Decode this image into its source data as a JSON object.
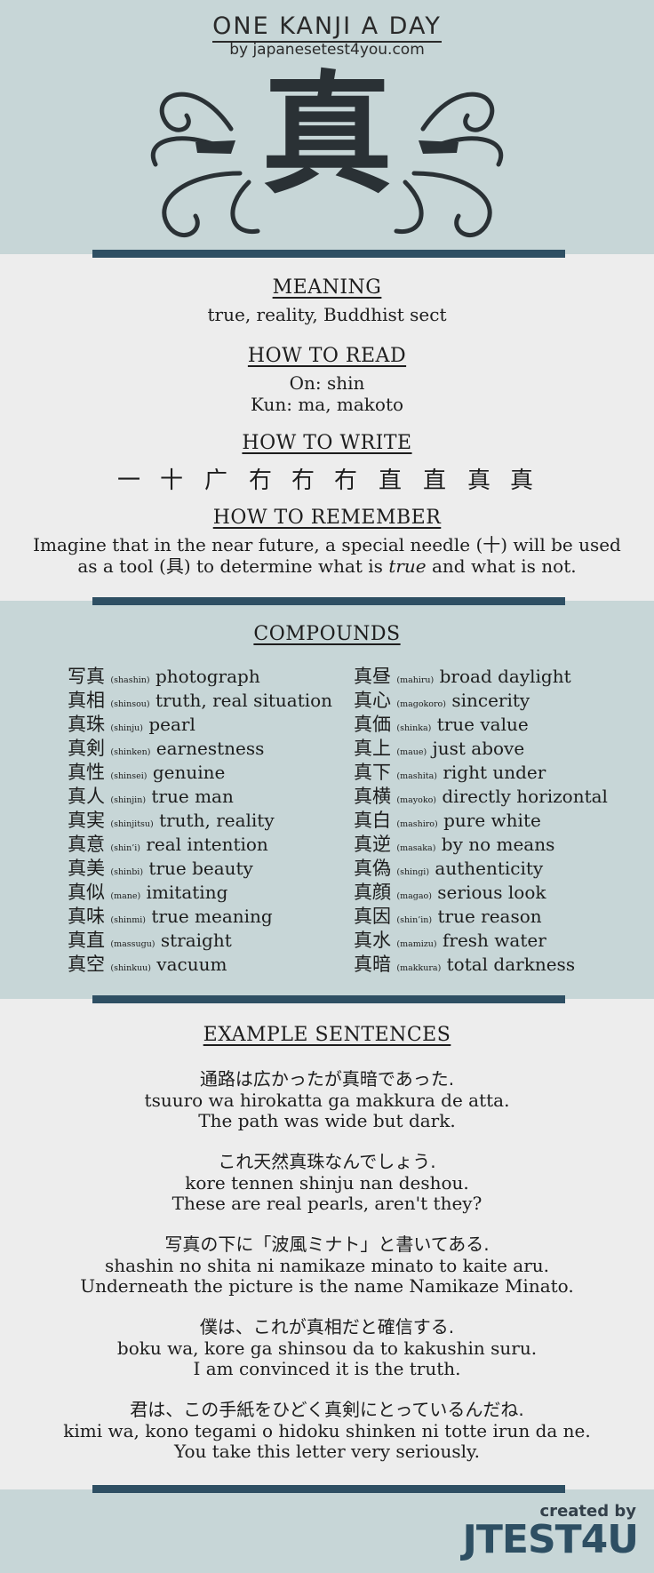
{
  "header": {
    "title": "ONE KANJI A DAY",
    "byline": "by japanesetest4you.com",
    "kanji": "真"
  },
  "meaning": {
    "heading": "MEANING",
    "text": "true, reality, Buddhist sect"
  },
  "read": {
    "heading": "HOW TO READ",
    "on": "On: shin",
    "kun": "Kun: ma, makoto"
  },
  "write": {
    "heading": "HOW TO WRITE",
    "strokes": [
      "一",
      "十",
      "广",
      "冇",
      "冇",
      "冇",
      "直",
      "直",
      "真",
      "真"
    ]
  },
  "remember": {
    "heading": "HOW TO REMEMBER",
    "line1": "Imagine that in the near future, a special needle (十) will be used",
    "line2_a": "as a tool (具) to determine what is ",
    "line2_em": "true",
    "line2_b": " and what is not."
  },
  "compounds": {
    "heading": "COMPOUNDS",
    "left": [
      {
        "k": "写真",
        "r": "(shashin)",
        "m": "photograph"
      },
      {
        "k": "真相",
        "r": "(shinsou)",
        "m": "truth, real situation"
      },
      {
        "k": "真珠",
        "r": "(shinju)",
        "m": "pearl"
      },
      {
        "k": "真剣",
        "r": "(shinken)",
        "m": "earnestness"
      },
      {
        "k": "真性",
        "r": "(shinsei)",
        "m": "genuine"
      },
      {
        "k": "真人",
        "r": "(shinjin)",
        "m": "true man"
      },
      {
        "k": "真実",
        "r": "(shinjitsu)",
        "m": "truth, reality"
      },
      {
        "k": "真意",
        "r": "(shin’i)",
        "m": "real intention"
      },
      {
        "k": "真美",
        "r": "(shinbi)",
        "m": "true beauty"
      },
      {
        "k": "真似",
        "r": "(mane)",
        "m": "imitating"
      },
      {
        "k": "真味",
        "r": "(shinmi)",
        "m": "true meaning"
      },
      {
        "k": "真直",
        "r": "(massugu)",
        "m": "straight"
      },
      {
        "k": "真空",
        "r": "(shinkuu)",
        "m": "vacuum"
      }
    ],
    "right": [
      {
        "k": "真昼",
        "r": "(mahiru)",
        "m": "broad daylight"
      },
      {
        "k": "真心",
        "r": "(magokoro)",
        "m": "sincerity"
      },
      {
        "k": "真価",
        "r": "(shinka)",
        "m": "true value"
      },
      {
        "k": "真上",
        "r": "(maue)",
        "m": "just above"
      },
      {
        "k": "真下",
        "r": "(mashita)",
        "m": "right under"
      },
      {
        "k": "真横",
        "r": "(mayoko)",
        "m": "directly horizontal"
      },
      {
        "k": "真白",
        "r": "(mashiro)",
        "m": "pure white"
      },
      {
        "k": "真逆",
        "r": "(masaka)",
        "m": "by no means"
      },
      {
        "k": "真偽",
        "r": "(shingi)",
        "m": "authenticity"
      },
      {
        "k": "真顔",
        "r": "(magao)",
        "m": "serious look"
      },
      {
        "k": "真因",
        "r": "(shin’in)",
        "m": "true reason"
      },
      {
        "k": "真水",
        "r": "(mamizu)",
        "m": "fresh water"
      },
      {
        "k": "真暗",
        "r": "(makkura)",
        "m": "total darkness"
      }
    ]
  },
  "examples": {
    "heading": "EXAMPLE SENTENCES",
    "items": [
      {
        "jp": "通路は広かったが真暗であった.",
        "romaji": "tsuuro wa hirokatta ga makkura de atta.",
        "en": "The path was wide but dark."
      },
      {
        "jp": "これ天然真珠なんでしょう.",
        "romaji": "kore tennen shinju nan deshou.",
        "en": "These are real pearls, aren't they?"
      },
      {
        "jp": "写真の下に「波風ミナト」と書いてある.",
        "romaji": "shashin no shita ni namikaze minato to kaite aru.",
        "en": "Underneath the picture is the name Namikaze Minato."
      },
      {
        "jp": "僕は、これが真相だと確信する.",
        "romaji": "boku wa, kore ga shinsou da to kakushin suru.",
        "en": "I am convinced it is the truth."
      },
      {
        "jp": "君は、この手紙をひどく真剣にとっているんだね.",
        "romaji": "kimi wa, kono tegami o hidoku shinken ni totte irun da ne.",
        "en": "You take this letter very seriously."
      }
    ]
  },
  "footer": {
    "created": "created by",
    "brand": "JTEST4U"
  }
}
